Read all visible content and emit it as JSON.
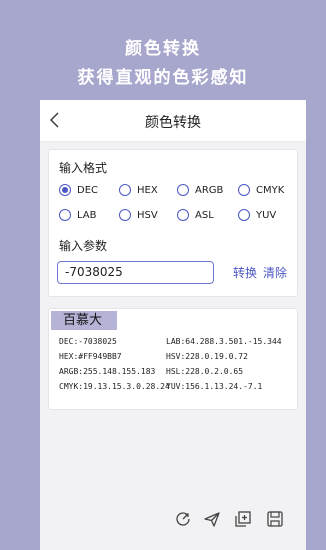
{
  "promo": {
    "title_line1": "颜色转换",
    "title_line2": "获得直观的色彩感知"
  },
  "appbar": {
    "title": "颜色转换",
    "back_icon": "chevron-left-icon"
  },
  "input_card": {
    "format_label": "输入格式",
    "formats": [
      {
        "label": "DEC",
        "checked": true
      },
      {
        "label": "HEX",
        "checked": false
      },
      {
        "label": "ARGB",
        "checked": false
      },
      {
        "label": "CMYK",
        "checked": false
      },
      {
        "label": "LAB",
        "checked": false
      },
      {
        "label": "HSV",
        "checked": false
      },
      {
        "label": "ASL",
        "checked": false
      },
      {
        "label": "YUV",
        "checked": false
      }
    ],
    "param_label": "输入参数",
    "param_value": "-7038025",
    "convert_label": "转换",
    "clear_label": "清除"
  },
  "result_card": {
    "color_name": "百慕大",
    "swatch_color": "#b5b4d6",
    "values": {
      "dec": "DEC:-7038025",
      "lab": "LAB:64.288.3.501.-15.344",
      "hex": "HEX:#FF949BB7",
      "hsv": "HSV:228.0.19.0.72",
      "argb": "ARGB:255.148.155.183",
      "hsl": "HSL:228.0.2.0.65",
      "cmyk": "CMYK:19.13.15.3.0.28.24",
      "yuv": "YUV:156.1.13.24.-7.1"
    }
  },
  "toolbar": {
    "icons": [
      "share-icon",
      "send-icon",
      "add-icon",
      "save-icon"
    ]
  },
  "colors": {
    "background": "#a7a6cd",
    "accent": "#4b56c4",
    "swatch": "#b5b4d6"
  }
}
